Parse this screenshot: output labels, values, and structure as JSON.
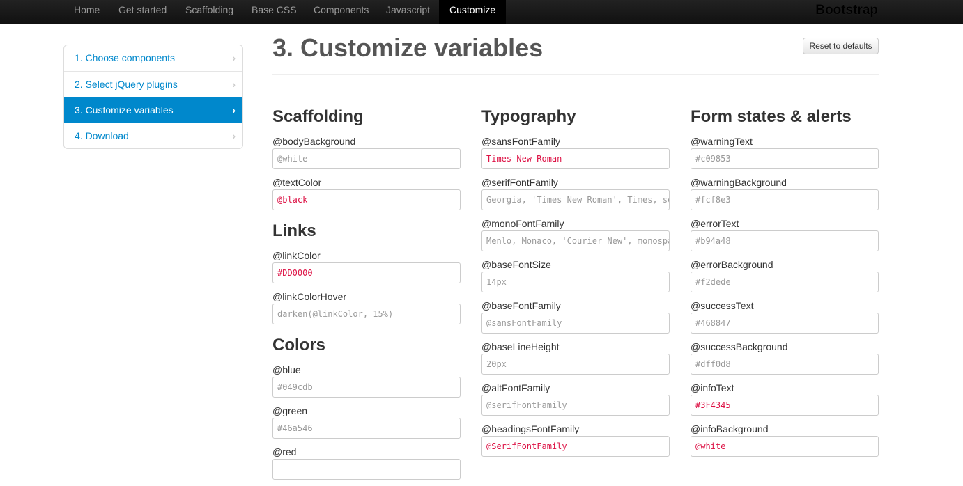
{
  "nav": {
    "items": [
      "Home",
      "Get started",
      "Scaffolding",
      "Base CSS",
      "Components",
      "Javascript",
      "Customize"
    ],
    "active": "Customize",
    "brand": "Bootstrap"
  },
  "sidebar": {
    "items": [
      "1. Choose components",
      "2. Select jQuery plugins",
      "3. Customize variables",
      "4. Download"
    ],
    "active_index": 2,
    "chevron": "›"
  },
  "page_title": "3. Customize variables",
  "reset_label": "Reset to defaults",
  "columns": [
    {
      "sections": [
        {
          "title": "Scaffolding",
          "fields": [
            {
              "label": "@bodyBackground",
              "placeholder": "@white",
              "value": ""
            },
            {
              "label": "@textColor",
              "placeholder": "",
              "value": "@black"
            }
          ]
        },
        {
          "title": "Links",
          "fields": [
            {
              "label": "@linkColor",
              "placeholder": "",
              "value": "#DD0000"
            },
            {
              "label": "@linkColorHover",
              "placeholder": "darken(@linkColor, 15%)",
              "value": ""
            }
          ]
        },
        {
          "title": "Colors",
          "fields": [
            {
              "label": "@blue",
              "placeholder": "#049cdb",
              "value": ""
            },
            {
              "label": "@green",
              "placeholder": "#46a546",
              "value": ""
            },
            {
              "label": "@red",
              "placeholder": "",
              "value": ""
            }
          ]
        }
      ]
    },
    {
      "sections": [
        {
          "title": "Typography",
          "fields": [
            {
              "label": "@sansFontFamily",
              "placeholder": "",
              "value": "Times New Roman"
            },
            {
              "label": "@serifFontFamily",
              "placeholder": "Georgia, 'Times New Roman', Times, serif",
              "value": ""
            },
            {
              "label": "@monoFontFamily",
              "placeholder": "Menlo, Monaco, 'Courier New', monospace",
              "value": ""
            },
            {
              "label": "@baseFontSize",
              "placeholder": "14px",
              "value": ""
            },
            {
              "label": "@baseFontFamily",
              "placeholder": "@sansFontFamily",
              "value": ""
            },
            {
              "label": "@baseLineHeight",
              "placeholder": "20px",
              "value": ""
            },
            {
              "label": "@altFontFamily",
              "placeholder": "@serifFontFamily",
              "value": ""
            },
            {
              "label": "@headingsFontFamily",
              "placeholder": "",
              "value": "@SerifFontFamily"
            }
          ]
        }
      ]
    },
    {
      "sections": [
        {
          "title": "Form states & alerts",
          "fields": [
            {
              "label": "@warningText",
              "placeholder": "#c09853",
              "value": ""
            },
            {
              "label": "@warningBackground",
              "placeholder": "#fcf8e3",
              "value": ""
            },
            {
              "label": "@errorText",
              "placeholder": "#b94a48",
              "value": ""
            },
            {
              "label": "@errorBackground",
              "placeholder": "#f2dede",
              "value": ""
            },
            {
              "label": "@successText",
              "placeholder": "#468847",
              "value": ""
            },
            {
              "label": "@successBackground",
              "placeholder": "#dff0d8",
              "value": ""
            },
            {
              "label": "@infoText",
              "placeholder": "",
              "value": "#3F4345"
            },
            {
              "label": "@infoBackground",
              "placeholder": "",
              "value": "@white"
            }
          ]
        }
      ]
    }
  ]
}
